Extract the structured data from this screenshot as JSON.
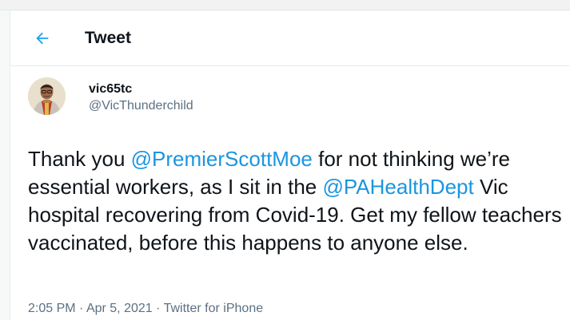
{
  "header": {
    "title": "Tweet",
    "back_icon": "arrow-left-icon"
  },
  "tweet": {
    "author": {
      "display_name": "vic65tc",
      "handle": "@VicThunderchild",
      "avatar": "avatar-photo"
    },
    "text": {
      "part1": "Thank you ",
      "mention1": "@PremierScottMoe",
      "part2": " for not thinking we’re essential workers, as I sit in the ",
      "mention2": "@PAHealthDept",
      "part3": " Vic hospital recovering from Covid-19. Get my fellow teachers vaccinated, before this happens to anyone else."
    },
    "meta": {
      "time": "2:05 PM",
      "separator": " · ",
      "date": "Apr 5, 2021",
      "source": "Twitter for iPhone"
    }
  },
  "colors": {
    "accent": "#1b95e0",
    "text": "#0f1419",
    "secondary": "#5b7083"
  }
}
